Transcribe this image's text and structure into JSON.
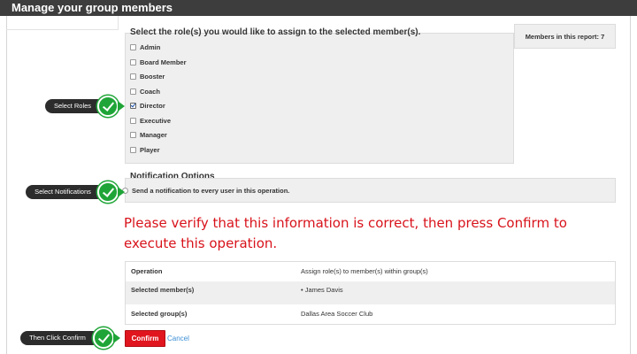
{
  "page": {
    "title": "Manage your group members"
  },
  "roles": {
    "heading": "Select the role(s) you would like to assign to the selected member(s).",
    "items": [
      {
        "label": "Admin",
        "checked": false
      },
      {
        "label": "Board Member",
        "checked": false
      },
      {
        "label": "Booster",
        "checked": false
      },
      {
        "label": "Coach",
        "checked": false
      },
      {
        "label": "Director",
        "checked": true
      },
      {
        "label": "Executive",
        "checked": false
      },
      {
        "label": "Manager",
        "checked": false
      },
      {
        "label": "Player",
        "checked": false
      }
    ]
  },
  "members": {
    "label": "Members in this report: 7"
  },
  "notifications": {
    "heading": "Notification Options",
    "option_label": "Send a notification to every user in this operation."
  },
  "verify": {
    "message": "Please verify that this information is correct, then press Confirm to execute this operation."
  },
  "summary": {
    "rows": [
      {
        "key": "Operation",
        "value": "Assign role(s) to member(s) within group(s)"
      },
      {
        "key": "Selected member(s)",
        "value": "•  James Davis"
      },
      {
        "key": "Selected group(s)",
        "value": "Dallas Area Soccer Club"
      }
    ]
  },
  "actions": {
    "confirm_label": "Confirm",
    "cancel_label": "Cancel"
  },
  "callouts": {
    "select_roles": "Select Roles",
    "select_notifications": "Select Notifications",
    "then_click_confirm": "Then Click Confirm"
  },
  "colors": {
    "accent_red": "#e0151d",
    "callout_green": "#1fa537",
    "link_blue": "#3b8fd6"
  }
}
